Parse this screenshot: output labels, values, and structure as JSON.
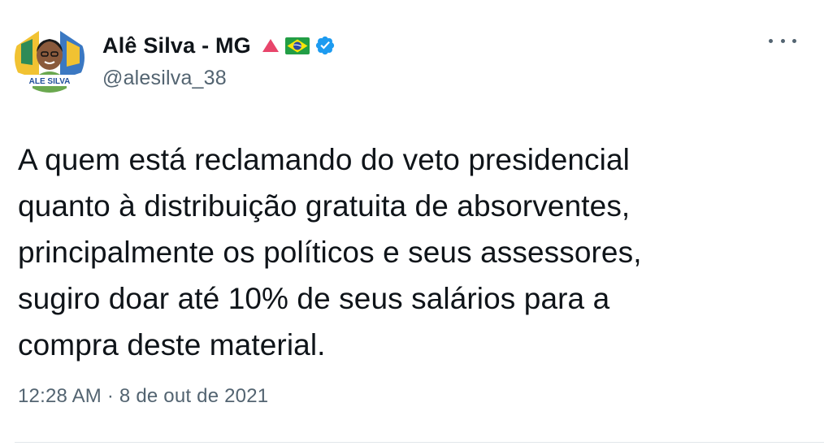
{
  "author": {
    "display_name": "Alê Silva - MG",
    "handle": "@alesilva_38",
    "avatar_caption": "ALE SILVA",
    "badges": [
      "red-triangle-icon",
      "brazil-flag-icon",
      "verified-badge-icon"
    ]
  },
  "tweet": {
    "text": "A quem está reclamando do veto presidencial\nquanto à distribuição gratuita de absorventes,\nprincipalmente os políticos e seus assessores,\nsugiro doar até 10% de seus salários para a\ncompra deste material.",
    "timestamp": "12:28 AM · 8 de out de 2021"
  },
  "colors": {
    "text_primary": "#0f1419",
    "text_secondary": "#536471",
    "verified": "#1d9bf0",
    "triangle": "#e8456b"
  }
}
